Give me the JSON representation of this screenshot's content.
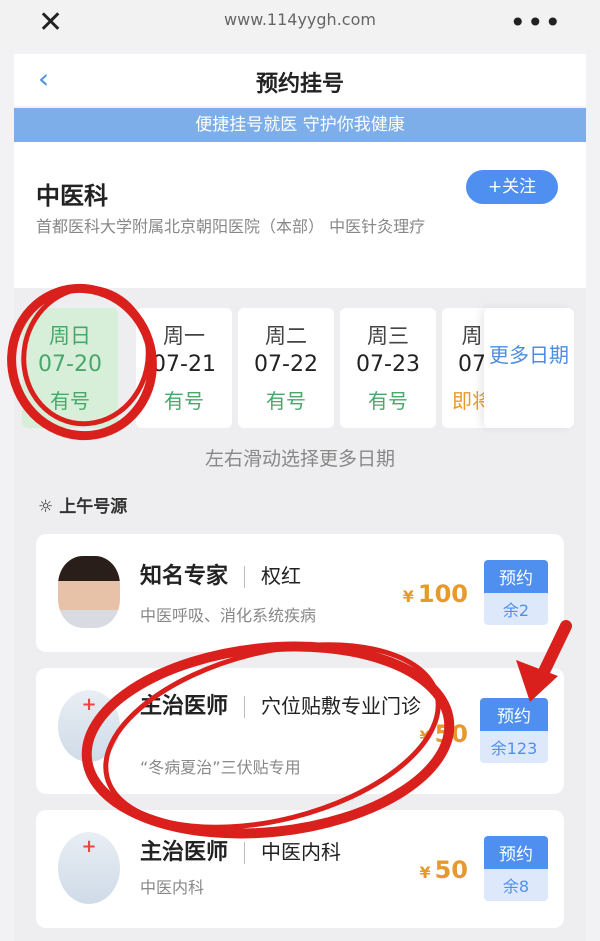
{
  "browser": {
    "url": "www.114yygh.com"
  },
  "nav": {
    "back": "‹",
    "title": "预约挂号"
  },
  "banner": "便捷挂号就医 守护你我健康",
  "department": {
    "name": "中医科",
    "follow": "+关注",
    "hospital": "首都医科大学附属北京朝阳医院（本部）  中医针灸理疗"
  },
  "dates": [
    {
      "weekday": "周日",
      "date": "07-20",
      "status": "有号"
    },
    {
      "weekday": "周一",
      "date": "07-21",
      "status": "有号"
    },
    {
      "weekday": "周二",
      "date": "07-22",
      "status": "有号"
    },
    {
      "weekday": "周三",
      "date": "07-23",
      "status": "有号"
    },
    {
      "weekday": "周",
      "date": "07",
      "status": "即将"
    }
  ],
  "more_dates": "更多日期",
  "swipe_hint": "左右滑动选择更多日期",
  "section_title": "上午号源",
  "doctors": [
    {
      "level": "知名专家",
      "name": "权红",
      "desc": "中医呼吸、消化系统疾病",
      "price": "100",
      "book": "预约",
      "remain": "余2"
    },
    {
      "level": "主治医师",
      "name": "穴位贴敷专业门诊",
      "desc": "“冬病夏治”三伏贴专用",
      "price": "50",
      "book": "预约",
      "remain": "余123"
    },
    {
      "level": "主治医师",
      "name": "中医内科",
      "desc": "中医内科",
      "price": "50",
      "book": "预约",
      "remain": "余8"
    }
  ],
  "currency": "¥",
  "colors": {
    "accent": "#4f8ff0",
    "available": "#4aa76b",
    "price": "#e79a2c",
    "annotation": "#d9201c"
  }
}
